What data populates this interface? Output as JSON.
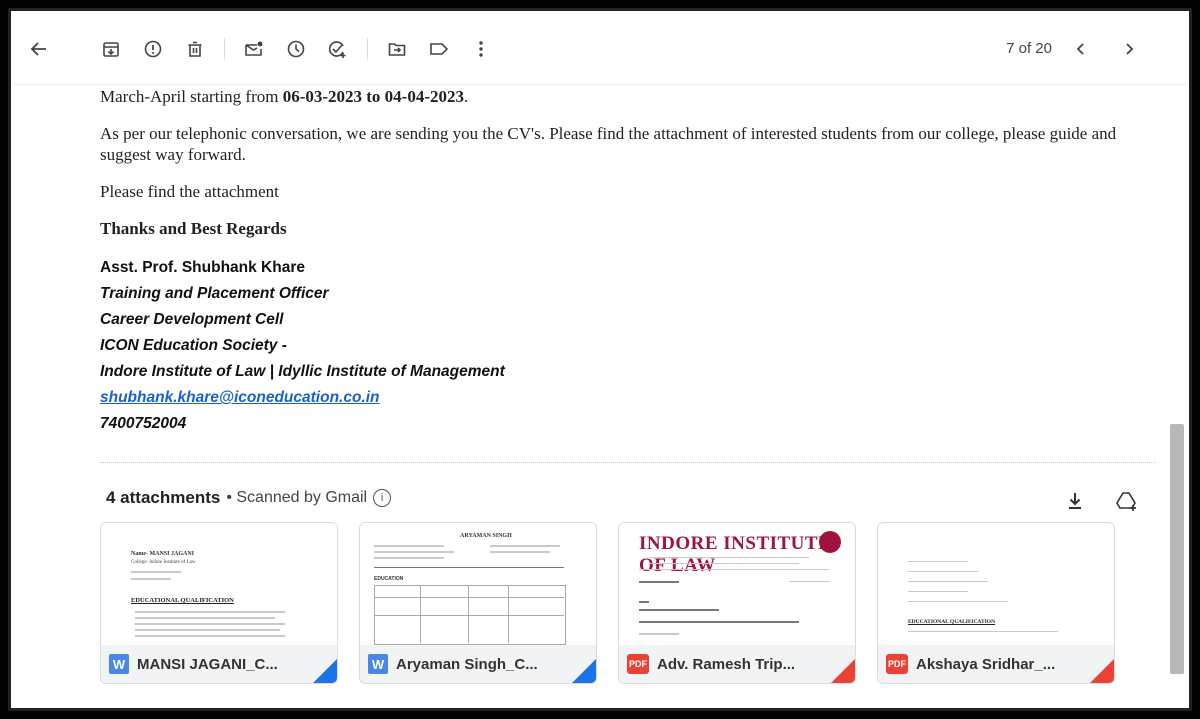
{
  "toolbar": {
    "count": "7 of 20",
    "icons": [
      "arrow-back-icon",
      "archive-icon",
      "report-spam-icon",
      "delete-icon",
      "mark-unread-icon",
      "snooze-icon",
      "add-task-icon",
      "move-to-icon",
      "label-icon",
      "more-vert-icon",
      "chevron-left-icon",
      "chevron-right-icon"
    ]
  },
  "email": {
    "line1_prefix": "March-April starting from ",
    "line1_bold": "06-03-2023 to 04-04-2023",
    "line1_suffix": ".",
    "para2": "As per our telephonic conversation, we are sending you the CV's. Please find the attachment of interested students from our college, please guide and suggest way forward.",
    "para3": "Please find the attachment",
    "regards": "Thanks and Best Regards",
    "signature": {
      "name": "Asst. Prof. Shubhank Khare",
      "title": "Training and Placement Officer",
      "dept": "Career Development Cell",
      "org": "ICON Education Society -",
      "institutes": "Indore Institute of Law | Idyllic Institute of Management",
      "email": "shubhank.khare@iconeducation.co.in",
      "phone": "7400752004"
    }
  },
  "attachments": {
    "count_label": "4 attachments",
    "scanned_label": "• Scanned by Gmail",
    "items": [
      {
        "name": "MANSI JAGANI_C...",
        "type": "W"
      },
      {
        "name": "Aryaman Singh_C...",
        "type": "W"
      },
      {
        "name": "Adv. Ramesh Trip...",
        "type": "PDF"
      },
      {
        "name": "Akshaya Sridhar_...",
        "type": "PDF"
      }
    ],
    "preview_texts": {
      "card1_name": "Name- MANSI JAGANI",
      "card1_college": "College: Indore Institute of Law",
      "card1_heading": "EDUCATIONAL QUALIFICATION",
      "card2_name": "ARYAMAN SINGH",
      "card2_section": "EDUCATION",
      "card3_title": "INDORE INSTITUTE OF LAW",
      "card4_heading": "EDUCATIONAL QUALIFICATION"
    }
  }
}
